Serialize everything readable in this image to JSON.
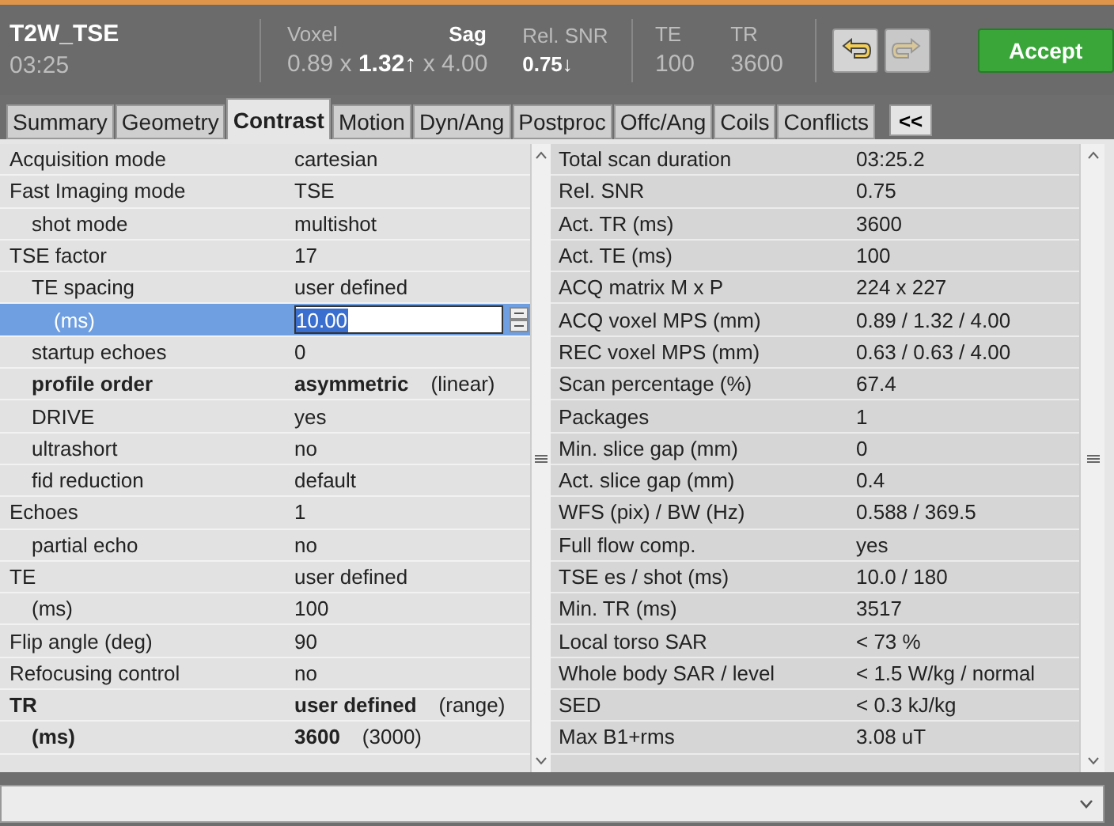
{
  "header": {
    "protocol": "T2W_TSE",
    "duration": "03:25",
    "voxel_label": "Voxel",
    "orientation": "Sag",
    "voxel_value": "0.89 x **1.32↑** x 4.00",
    "snr_label": "Rel. SNR",
    "snr_value": "0.75↓",
    "te_label": "TE",
    "te_value": "100",
    "tr_label": "TR",
    "tr_value": "3600",
    "undo_disabled": false,
    "redo_disabled": true,
    "accept": "Accept"
  },
  "tabs": [
    {
      "label": "Summary",
      "selected": false
    },
    {
      "label": "Geometry",
      "selected": false
    },
    {
      "label": "Contrast",
      "selected": true
    },
    {
      "label": "Motion",
      "selected": false
    },
    {
      "label": "Dyn/Ang",
      "selected": false
    },
    {
      "label": "Postproc",
      "selected": false
    },
    {
      "label": "Offc/Ang",
      "selected": false
    },
    {
      "label": "Coils",
      "selected": false
    },
    {
      "label": "Conflicts",
      "selected": false
    }
  ],
  "collapse_button": "<<",
  "parameters": [
    {
      "label": "Acquisition  mode",
      "value": "cartesian",
      "kind": "text",
      "bold": false,
      "selected": false
    },
    {
      "label": "Fast  Imaging  mode",
      "value": "TSE",
      "kind": "text",
      "bold": false,
      "selected": false,
      "children": [
        {
          "label": "shot mode",
          "value": "multishot",
          "kind": "text",
          "bold": false,
          "selected": false
        }
      ]
    },
    {
      "label": "TSE factor",
      "value": "17",
      "kind": "text",
      "bold": false,
      "selected": false,
      "children": [
        {
          "label": "TE spacing",
          "value": "user defined",
          "kind": "text",
          "bold": false,
          "selected": false,
          "children": [
            {
              "label": "(ms)",
              "value": "10.00",
              "kind": "input",
              "bold": false,
              "selected": true
            }
          ]
        },
        {
          "label": "startup  echoes",
          "value": "0",
          "kind": "text",
          "bold": false,
          "selected": false
        },
        {
          "label": "profile order",
          "value": "asymmetric",
          "hint": "(linear)",
          "kind": "text",
          "bold": true,
          "selected": false
        },
        {
          "label": "DRIVE",
          "value": "yes",
          "kind": "text",
          "bold": false,
          "selected": false
        },
        {
          "label": "ultrashort",
          "value": "no",
          "kind": "text",
          "bold": false,
          "selected": false
        },
        {
          "label": "fid reduction",
          "value": "default",
          "kind": "text",
          "bold": false,
          "selected": false
        }
      ]
    },
    {
      "label": "Echoes",
      "value": "1",
      "kind": "text",
      "bold": false,
      "selected": false,
      "children": [
        {
          "label": "partial echo",
          "value": "no",
          "kind": "text",
          "bold": false,
          "selected": false
        }
      ]
    },
    {
      "label": "TE",
      "value": "user defined",
      "kind": "text",
      "bold": false,
      "selected": false,
      "children": [
        {
          "label": "(ms)",
          "value": "100",
          "kind": "text",
          "bold": false,
          "selected": false
        }
      ]
    },
    {
      "label": "Flip  angle  (deg)",
      "value": "90",
      "kind": "text",
      "bold": false,
      "selected": false
    },
    {
      "label": "Refocusing  control",
      "value": "no",
      "kind": "text",
      "bold": false,
      "selected": false
    },
    {
      "label": "TR",
      "value": "user defined",
      "hint": "(range)",
      "kind": "text",
      "bold": true,
      "selected": false,
      "children": [
        {
          "label": "(ms)",
          "value": "3600",
          "hint": "(3000)",
          "kind": "text",
          "bold": true,
          "selected": false
        }
      ]
    }
  ],
  "info": [
    {
      "label": "Total  scan  duration",
      "value": "03:25.2"
    },
    {
      "label": "Rel. SNR",
      "value": "0.75"
    },
    {
      "label": "Act. TR (ms)",
      "value": "3600"
    },
    {
      "label": "Act. TE (ms)",
      "value": "100"
    },
    {
      "label": "ACQ matrix M x P",
      "value": "224 x 227"
    },
    {
      "label": "ACQ  voxel MPS  (mm)",
      "value": "0.89 / 1.32 / 4.00"
    },
    {
      "label": "REC voxel MPS  (mm)",
      "value": "0.63 / 0.63 / 4.00"
    },
    {
      "label": "Scan  percentage  (%)",
      "value": "67.4"
    },
    {
      "label": "Packages",
      "value": "1"
    },
    {
      "label": "Min.  slice  gap  (mm)",
      "value": "0"
    },
    {
      "label": "Act.  slice  gap  (mm)",
      "value": "0.4"
    },
    {
      "label": "WFS  (pix)  /  BW  (Hz)",
      "value": "0.588 / 369.5"
    },
    {
      "label": "Full  flow  comp.",
      "value": "yes"
    },
    {
      "label": "TSE  es  /  shot (ms)",
      "value": "10.0 / 180"
    },
    {
      "label": "Min. TR (ms)",
      "value": "3517"
    },
    {
      "label": "Local  torso  SAR",
      "value": "<  73 %"
    },
    {
      "label": "Whole  body  SAR  /  level",
      "value": "< 1.5 W/kg / normal"
    },
    {
      "label": "SED",
      "value": "< 0.3 kJ/kg"
    },
    {
      "label": "Max B1+rms",
      "value": "3.08 uT"
    }
  ]
}
